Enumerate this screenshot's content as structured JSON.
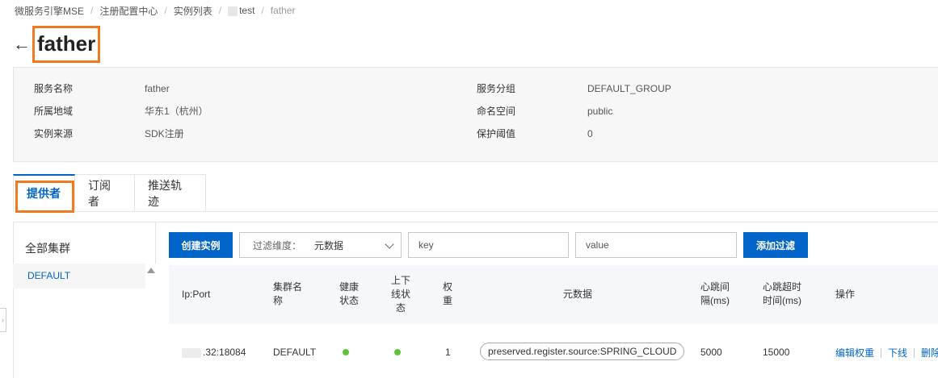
{
  "breadcrumb": {
    "items": [
      "微服务引擎MSE",
      "注册配置中心",
      "实例列表",
      "test",
      "father"
    ]
  },
  "title": "father",
  "info": {
    "service_name_label": "服务名称",
    "service_name": "father",
    "region_label": "所属地域",
    "region": "华东1（杭州）",
    "source_label": "实例来源",
    "source": "SDK注册",
    "group_label": "服务分组",
    "group": "DEFAULT_GROUP",
    "namespace_label": "命名空间",
    "namespace": "public",
    "threshold_label": "保护阈值",
    "threshold": "0"
  },
  "tabs": [
    "提供者",
    "订阅者",
    "推送轨迹"
  ],
  "cluster": {
    "title": "全部集群",
    "items": [
      "DEFAULT"
    ]
  },
  "toolbar": {
    "create_label": "创建实例",
    "filter_label": "过滤维度：",
    "filter_value": "元数据",
    "key_placeholder": "key",
    "value_placeholder": "value",
    "add_filter_label": "添加过滤"
  },
  "table": {
    "headers": {
      "ip_port": "Ip:Port",
      "cluster_1": "集群名",
      "cluster_2": "称",
      "health_1": "健康",
      "health_2": "状态",
      "online_1": "上下",
      "online_2": "线状",
      "online_3": "态",
      "weight_1": "权",
      "weight_2": "重",
      "metadata": "元数据",
      "hb_interval_1": "心跳间",
      "hb_interval_2": "隔(ms)",
      "hb_timeout_1": "心跳超时",
      "hb_timeout_2": "时间(ms)",
      "ops": "操作"
    },
    "rows": [
      {
        "ip_port": ".32:18084",
        "cluster": "DEFAULT",
        "weight": "1",
        "metadata": "preserved.register.source:SPRING_CLOUD",
        "hb_interval": "5000",
        "hb_timeout": "15000",
        "op_edit": "编辑权重",
        "op_offline": "下线",
        "op_delete": "删除"
      }
    ]
  },
  "colors": {
    "primary": "#0064c8",
    "highlight": "#f07a22",
    "healthy": "#5ac43a"
  }
}
